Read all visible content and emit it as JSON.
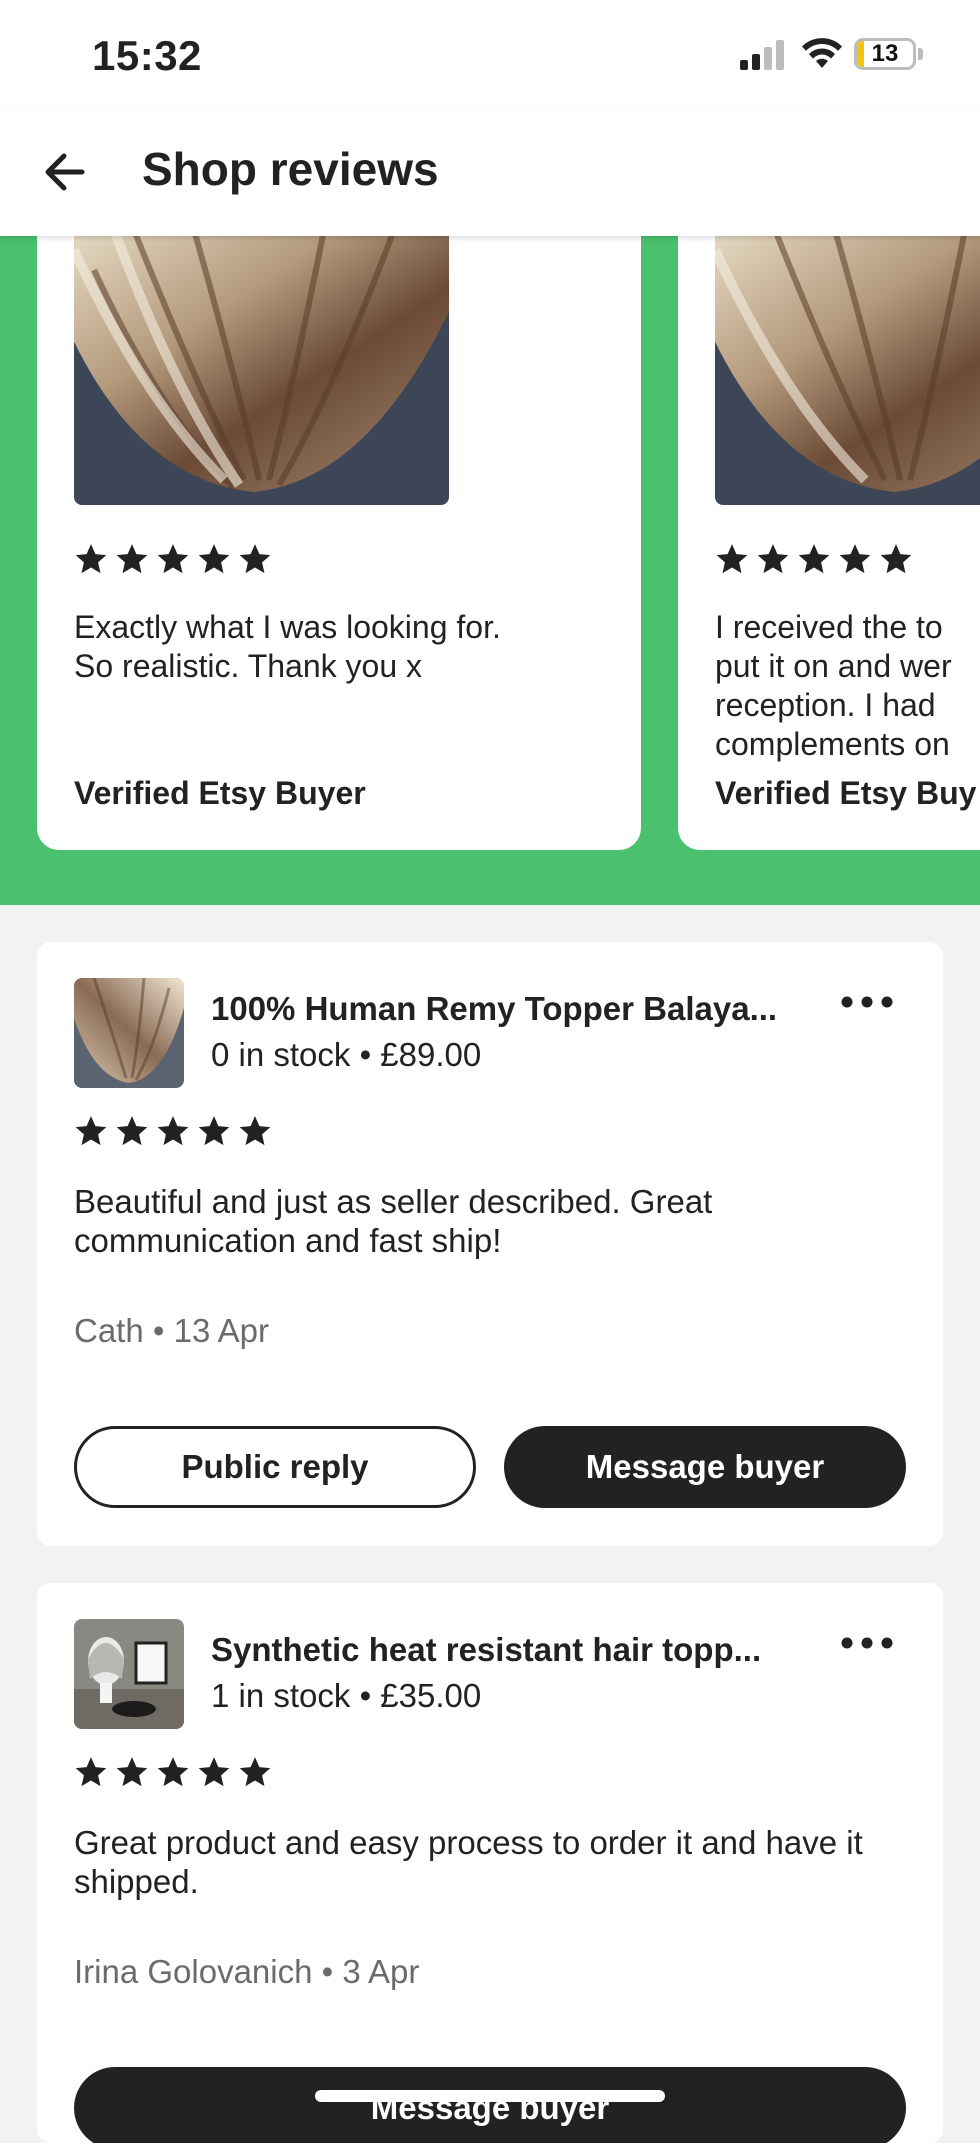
{
  "status": {
    "time": "15:32",
    "battery": "13",
    "battery_level": 0.13
  },
  "header": {
    "title": "Shop reviews",
    "back_icon": "arrow-left-icon"
  },
  "featured_reviews": [
    {
      "rating": 5,
      "text": "Exactly what I was looking for.\nSo realistic. Thank you x",
      "buyer": "Verified Etsy Buyer"
    },
    {
      "rating": 5,
      "text": "I received the to\nput it on and wer\nreception. I had\ncomplements on",
      "buyer": "Verified Etsy Buy"
    }
  ],
  "reviews": [
    {
      "product_title": "100% Human Remy Topper Balaya...",
      "product_meta": "0 in stock • £89.00",
      "rating": 5,
      "text": "Beautiful and just as seller described. Great communication and fast ship!",
      "author": "Cath • 13 Apr",
      "public_reply_label": "Public reply",
      "message_label": "Message buyer"
    },
    {
      "product_title": "Synthetic heat resistant hair topp...",
      "product_meta": "1 in stock • £35.00",
      "rating": 5,
      "text": "Great product and easy process to order it and have it shipped.",
      "author": "Irina Golovanich • 3 Apr",
      "message_label": "Message buyer"
    }
  ],
  "colors": {
    "accent_green": "#4bc06e",
    "dark": "#222222",
    "muted": "#6b6b6b"
  }
}
